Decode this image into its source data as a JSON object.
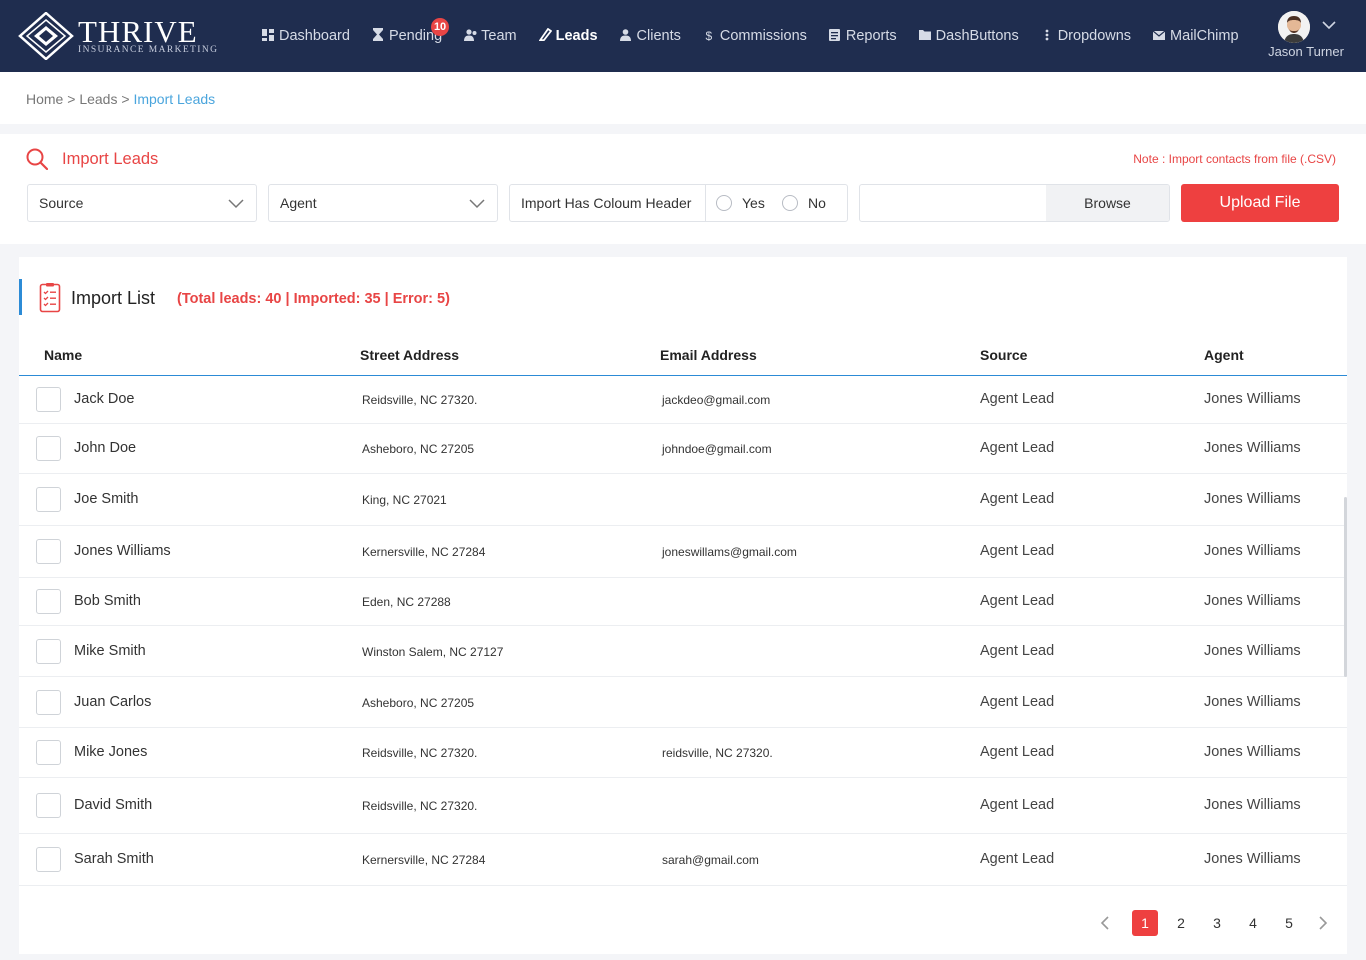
{
  "brand": {
    "name": "THRIVE",
    "tagline": "INSURANCE MARKETING"
  },
  "nav": [
    {
      "label": "Dashboard",
      "icon": "dashboard-icon"
    },
    {
      "label": "Pending",
      "icon": "hourglass-icon",
      "badge": "10"
    },
    {
      "label": "Team",
      "icon": "team-icon"
    },
    {
      "label": "Leads",
      "icon": "leads-icon",
      "active": true
    },
    {
      "label": "Clients",
      "icon": "client-icon"
    },
    {
      "label": "Commissions",
      "icon": "dollar-icon"
    },
    {
      "label": "Reports",
      "icon": "report-icon"
    },
    {
      "label": "DashButtons",
      "icon": "folder-icon"
    },
    {
      "label": "Dropdowns",
      "icon": "dots-vertical-icon"
    },
    {
      "label": "MailChimp",
      "icon": "mail-icon"
    }
  ],
  "user": {
    "name": "Jason Turner"
  },
  "breadcrumb": {
    "home": "Home",
    "sep1": ">",
    "leads": "Leads",
    "sep2": ">",
    "current": "Import Leads"
  },
  "import": {
    "title": "Import Leads",
    "note": "Note : Import contacts from file (.CSV)",
    "source_placeholder": "Source",
    "agent_placeholder": "Agent",
    "header_label": "Import Has Coloum Header",
    "yes": "Yes",
    "no": "No",
    "browse": "Browse",
    "upload": "Upload File"
  },
  "list": {
    "title": "Import List",
    "stats": "(Total leads: 40 | Imported: 35 | Error: 5)",
    "columns": {
      "name": "Name",
      "street": "Street Address",
      "email": "Email Address",
      "source": "Source",
      "agent": "Agent"
    },
    "rows": [
      {
        "name": "Jack Doe",
        "street": "Reidsville, NC 27320.",
        "email": "jackdeo@gmail.com",
        "source": "Agent Lead",
        "agent": "Jones Williams"
      },
      {
        "name": "John Doe",
        "street": "Asheboro, NC 27205",
        "email": "johndoe@gmail.com",
        "source": "Agent Lead",
        "agent": "Jones Williams"
      },
      {
        "name": "Joe Smith",
        "street": "King, NC 27021",
        "email": "",
        "source": "Agent Lead",
        "agent": "Jones Williams"
      },
      {
        "name": "Jones Williams",
        "street": "Kernersville, NC 27284",
        "email": "joneswillams@gmail.com",
        "source": "Agent Lead",
        "agent": "Jones Williams"
      },
      {
        "name": "Bob Smith",
        "street": "Eden, NC 27288",
        "email": "",
        "source": "Agent Lead",
        "agent": "Jones Williams"
      },
      {
        "name": "Mike Smith",
        "street": "Winston Salem, NC 27127",
        "email": "",
        "source": "Agent Lead",
        "agent": "Jones Williams"
      },
      {
        "name": "Juan Carlos",
        "street": "Asheboro, NC 27205",
        "email": "",
        "source": "Agent Lead",
        "agent": "Jones Williams"
      },
      {
        "name": "Mike Jones",
        "street": "Reidsville, NC 27320.",
        "email": "reidsville, NC 27320.",
        "source": "Agent Lead",
        "agent": "Jones Williams"
      },
      {
        "name": "David Smith",
        "street": "Reidsville, NC 27320.",
        "email": "",
        "source": "Agent Lead",
        "agent": "Jones Williams"
      },
      {
        "name": "Sarah Smith",
        "street": "Kernersville, NC 27284",
        "email": "sarah@gmail.com",
        "source": "Agent Lead",
        "agent": "Jones Williams"
      }
    ]
  },
  "pagination": {
    "pages": [
      "1",
      "2",
      "3",
      "4",
      "5"
    ],
    "current": "1"
  },
  "colors": {
    "nav_bg": "#1f2d4f",
    "accent_red": "#ee4040",
    "accent_blue": "#2c8bd6",
    "link_blue": "#4aa5dd"
  }
}
